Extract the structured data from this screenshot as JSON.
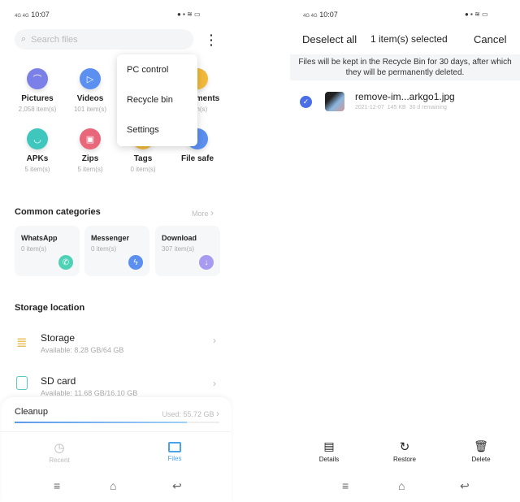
{
  "left": {
    "status": {
      "time": "10:07",
      "signal": "4G 4G"
    },
    "search_placeholder": "Search files",
    "categories": [
      {
        "label": "Pictures",
        "count": "2,058  item(s)",
        "color": "#7b7fe8",
        "icon": "mountain-icon"
      },
      {
        "label": "Videos",
        "count": "101  item(s)",
        "color": "#5b8ff0",
        "icon": "play-icon"
      },
      {
        "label": "Documents",
        "count": "item(s)",
        "color": "#f2b93b",
        "icon": "document-icon"
      },
      {
        "label": "APKs",
        "count": "5  item(s)",
        "color": "#3fc7bd",
        "icon": "android-icon"
      },
      {
        "label": "Zips",
        "count": "5  item(s)",
        "color": "#e9677a",
        "icon": "zip-icon"
      },
      {
        "label": "Tags",
        "count": "0  item(s)",
        "color": "#f2b93b",
        "icon": "tag-icon"
      },
      {
        "label": "File safe",
        "count": "",
        "color": "#5b8ff0",
        "icon": "safe-icon"
      }
    ],
    "menu": [
      "PC control",
      "Recycle bin",
      "Settings"
    ],
    "common": {
      "title": "Common categories",
      "more": "More",
      "cards": [
        {
          "title": "WhatsApp",
          "count": "0  item(s)",
          "color": "#4fd1b5",
          "icon": "whatsapp-icon"
        },
        {
          "title": "Messenger",
          "count": "0  item(s)",
          "color": "#5b8ff0",
          "icon": "messenger-icon"
        },
        {
          "title": "Download",
          "count": "307  item(s)",
          "color": "#a79af0",
          "icon": "download-icon"
        }
      ]
    },
    "storage": {
      "title": "Storage location",
      "items": [
        {
          "name": "Storage",
          "avail": "Available: 8.28 GB/64 GB"
        },
        {
          "name": "SD card",
          "avail": "Available: 11.68 GB/16.10 GB"
        }
      ]
    },
    "cleanup": {
      "label": "Cleanup",
      "used": "Used: 55.72 GB",
      "fill_pct": 84
    },
    "tabs": [
      {
        "label": "Recent"
      },
      {
        "label": "Files",
        "active": true
      }
    ],
    "accent": "#4aa3e8"
  },
  "right": {
    "status": {
      "time": "10:07"
    },
    "deselect": "Deselect all",
    "selected": "1 item(s) selected",
    "cancel": "Cancel",
    "banner": "Files will be kept in the Recycle Bin for 30 days, after which they will be permanently deleted.",
    "file": {
      "name": "remove-im...arkgo1.jpg",
      "date": "2021-12-07",
      "size": "145 KB",
      "remaining": "30 d remaining",
      "checked": true
    },
    "actions": [
      {
        "label": "Details",
        "icon": "details-icon"
      },
      {
        "label": "Restore",
        "icon": "restore-icon"
      },
      {
        "label": "Delete",
        "icon": "trash-icon"
      }
    ]
  }
}
